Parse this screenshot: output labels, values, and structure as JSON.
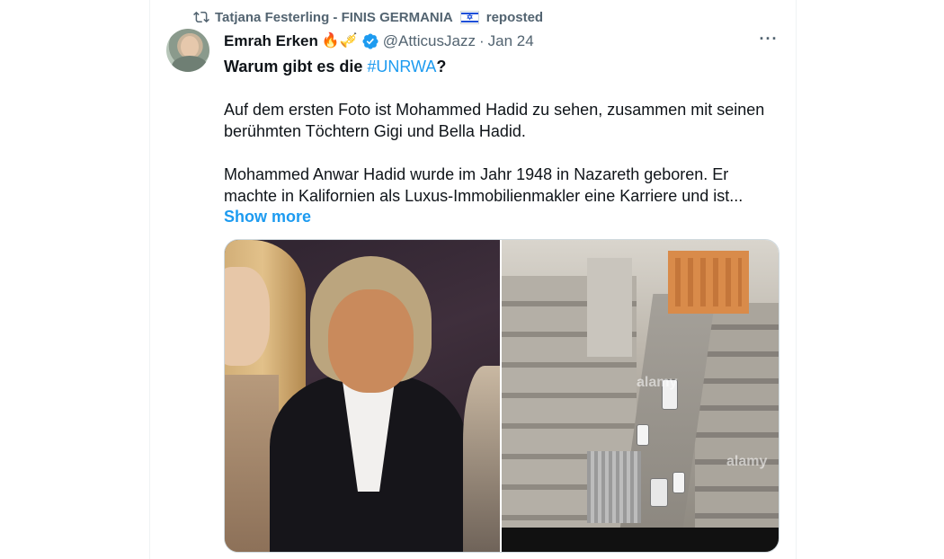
{
  "repost": {
    "user": "Tatjana Festerling - FINIS GERMANIA",
    "label": "reposted"
  },
  "tweet": {
    "author_name": "Emrah Erken",
    "author_emoji": "🔥🎺",
    "handle": "@AtticusJazz",
    "separator": "·",
    "date": "Jan 24",
    "more_label": "···",
    "headline_prefix": "Warum gibt es die ",
    "hashtag": "#UNRWA",
    "headline_suffix": "?",
    "paragraph_1": "Auf dem ersten Foto ist Mohammed Hadid zu sehen, zusammen mit seinen berühmten Töchtern Gigi und Bella Hadid.",
    "paragraph_2": "Mohammed Anwar Hadid wurde im Jahr 1948 in Nazareth geboren. Er machte in Kalifornien als Luxus-Immobilienmakler eine Karriere und ist...",
    "show_more": "Show more"
  },
  "media": {
    "watermark_1": "alamy",
    "watermark_2": "alamy"
  },
  "colors": {
    "accent": "#1d9bf0",
    "secondary_text": "#536471",
    "primary_text": "#0f1419",
    "border": "#cfd9de"
  },
  "icons": {
    "repost": "repost-icon",
    "verified": "verified-badge-icon",
    "flag": "israel-flag-icon",
    "more": "more-horizontal-icon"
  }
}
